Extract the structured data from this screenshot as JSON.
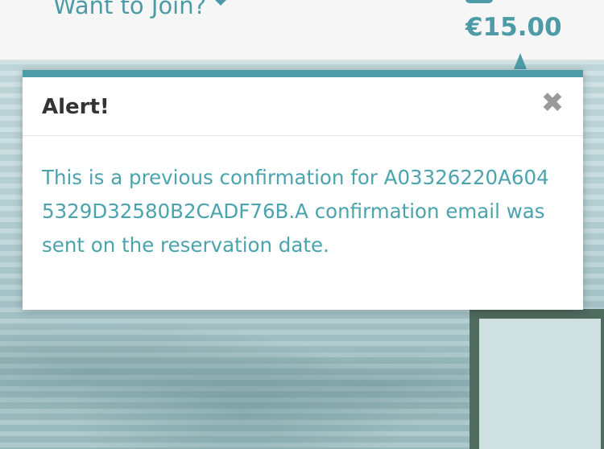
{
  "header": {
    "join_label": "Want to Join?",
    "price": "€15.00"
  },
  "modal": {
    "title": "Alert!",
    "close_symbol": "✖",
    "message": "This is a previous confirmation for A03326220A6045329D32580B2CADF76B.A confirmation email was sent on the reservation date."
  },
  "colors": {
    "accent": "#4e9ba8",
    "message_text": "#4aa3ad",
    "title_text": "#333333",
    "close_icon": "#9a9a9a"
  },
  "icons": {
    "join_dropdown": "chevron-down-icon",
    "close": "close-icon",
    "cart": "cart-badge"
  }
}
